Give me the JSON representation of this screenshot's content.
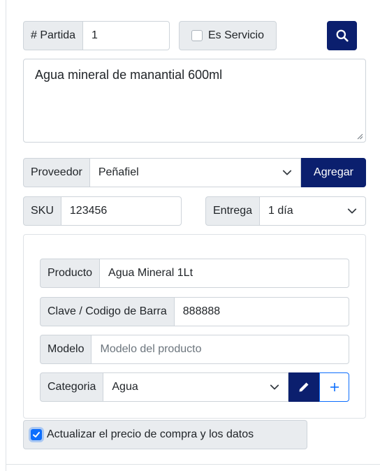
{
  "partida": {
    "label": "# Partida",
    "value": "1"
  },
  "servicio": {
    "label": "Es Servicio",
    "checked": false
  },
  "search": {
    "icon": "search-icon"
  },
  "description": {
    "value": "Agua mineral de manantial 600ml"
  },
  "proveedor": {
    "label": "Proveedor",
    "value": "Peñafiel",
    "add_label": "Agregar"
  },
  "sku": {
    "label": "SKU",
    "value": "123456"
  },
  "entrega": {
    "label": "Entrega",
    "value": "1 día"
  },
  "producto": {
    "label": "Producto",
    "value": "Agua Mineral 1Lt"
  },
  "clave": {
    "label": "Clave / Codigo de Barra",
    "value": "888888"
  },
  "modelo": {
    "label": "Modelo",
    "placeholder": "Modelo del producto"
  },
  "categoria": {
    "label": "Categoria",
    "value": "Agua",
    "edit_icon": "pencil-icon",
    "add_icon": "plus-icon"
  },
  "actualizar": {
    "label": "Actualizar el precio de compra y los datos",
    "checked": true
  },
  "colors": {
    "navy": "#0b1f6e",
    "primary": "#0d6efd",
    "addon_bg": "#e9ecef",
    "border": "#ced4da"
  }
}
